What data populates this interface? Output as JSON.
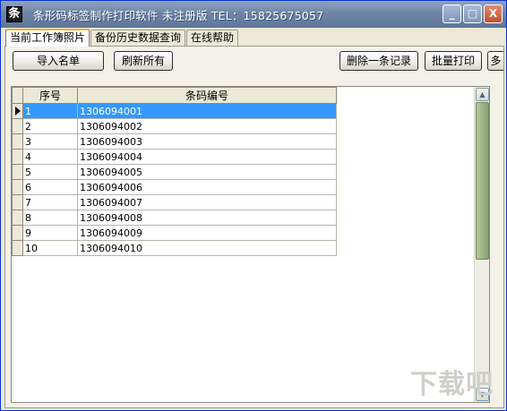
{
  "window": {
    "title": "条形码标签制作打印软件 未注册版 TEL：15825675057",
    "icon_glyph": "条",
    "controls": {
      "minimize": "_",
      "maximize": "□",
      "close": "X"
    }
  },
  "tabs": [
    {
      "label": "当前工作簿照片",
      "active": true
    },
    {
      "label": "备份历史数据查询",
      "active": false
    },
    {
      "label": "在线帮助",
      "active": false
    }
  ],
  "toolbar": {
    "import_label": "导入名单",
    "refresh_label": "刷新所有",
    "delete_label": "删除一条记录",
    "batch_print_label": "批量打印",
    "overflow_label": "多"
  },
  "grid": {
    "columns": [
      "序号",
      "条码编号"
    ],
    "rows": [
      {
        "index": "1",
        "code": "1306094001"
      },
      {
        "index": "2",
        "code": "1306094002"
      },
      {
        "index": "3",
        "code": "1306094003"
      },
      {
        "index": "4",
        "code": "1306094004"
      },
      {
        "index": "5",
        "code": "1306094005"
      },
      {
        "index": "6",
        "code": "1306094006"
      },
      {
        "index": "7",
        "code": "1306094007"
      },
      {
        "index": "8",
        "code": "1306094008"
      },
      {
        "index": "9",
        "code": "1306094009"
      },
      {
        "index": "10",
        "code": "1306094010"
      }
    ],
    "selected_row": 1
  },
  "watermark": "下载吧",
  "colors": {
    "selection": "#3399ff",
    "titlebar": "#6e86a8"
  }
}
